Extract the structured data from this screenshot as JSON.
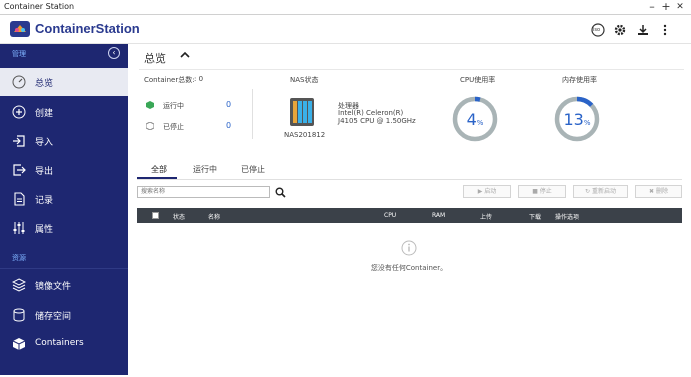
{
  "window": {
    "title": "Container Station",
    "controls": [
      "–",
      "+",
      "✕"
    ]
  },
  "app": {
    "brand": "ContainerStation",
    "accent": "#1e2771",
    "link_color": "#2a63c8"
  },
  "header_icons": [
    "notification-icon",
    "settings-icon",
    "download-icon",
    "more-icon"
  ],
  "header_badge": "iso",
  "sidebar": {
    "section_manage": "管理",
    "section_resources": "资源",
    "items": [
      {
        "label": "总览",
        "icon": "dashboard-icon",
        "active": true
      },
      {
        "label": "创建",
        "icon": "create-icon"
      },
      {
        "label": "导入",
        "icon": "import-icon"
      },
      {
        "label": "导出",
        "icon": "export-icon"
      },
      {
        "label": "记录",
        "icon": "log-icon"
      },
      {
        "label": "属性",
        "icon": "properties-icon"
      }
    ],
    "resources": [
      {
        "label": "镜像文件",
        "icon": "layers-icon"
      },
      {
        "label": "储存空间",
        "icon": "storage-icon"
      },
      {
        "label": "Containers",
        "icon": "container-icon"
      }
    ]
  },
  "overview": {
    "title": "总览",
    "container_total_label": "Container总数: ",
    "container_total": ": 0",
    "running_label": "运行中",
    "running_count": "0",
    "stopped_label": "已停止",
    "stopped_count": "0",
    "nas_status_label": "NAS状态",
    "nas_name": "NAS201812",
    "processor_label": "处理器",
    "processor_line1": "Intel(R) Celeron(R)",
    "processor_line2": "J4105 CPU @ 1.50GHz",
    "cpu_label": "CPU使用率",
    "cpu_value": "4",
    "cpu_percent": 4,
    "mem_label": "内存使用率",
    "mem_value": "13",
    "mem_percent": 13,
    "pct_sign": "%"
  },
  "tabs": [
    "全部",
    "运行中",
    "已停止"
  ],
  "search": {
    "placeholder": "搜索名称"
  },
  "actions": [
    "▶ 启动",
    "■ 停止",
    "↻ 重新启动",
    "✖ 删除"
  ],
  "table": {
    "columns": [
      "状态",
      "名称",
      "CPU",
      "RAM",
      "上传",
      "下载",
      "操作选项"
    ]
  },
  "empty_message": "您没有任何Container。"
}
